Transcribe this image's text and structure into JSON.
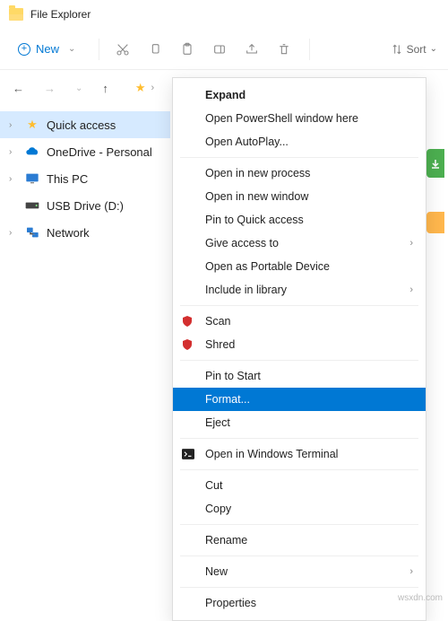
{
  "titlebar": {
    "title": "File Explorer"
  },
  "toolbar": {
    "new": "New",
    "sort": "Sort"
  },
  "sidebar": {
    "items": [
      {
        "label": "Quick access"
      },
      {
        "label": "OneDrive - Personal"
      },
      {
        "label": "This PC"
      },
      {
        "label": "USB Drive (D:)"
      },
      {
        "label": "Network"
      }
    ]
  },
  "context_menu": {
    "groups": [
      [
        {
          "label": "Expand",
          "bold": true
        },
        {
          "label": "Open PowerShell window here"
        },
        {
          "label": "Open AutoPlay..."
        }
      ],
      [
        {
          "label": "Open in new process"
        },
        {
          "label": "Open in new window"
        },
        {
          "label": "Pin to Quick access"
        },
        {
          "label": "Give access to",
          "submenu": true
        },
        {
          "label": "Open as Portable Device"
        },
        {
          "label": "Include in library",
          "submenu": true
        }
      ],
      [
        {
          "label": "Scan",
          "icon": "shield-red"
        },
        {
          "label": "Shred",
          "icon": "shield-red"
        }
      ],
      [
        {
          "label": "Pin to Start"
        },
        {
          "label": "Format...",
          "highlight": true
        },
        {
          "label": "Eject"
        }
      ],
      [
        {
          "label": "Open in Windows Terminal",
          "icon": "terminal"
        }
      ],
      [
        {
          "label": "Cut"
        },
        {
          "label": "Copy"
        }
      ],
      [
        {
          "label": "Rename"
        }
      ],
      [
        {
          "label": "New",
          "submenu": true
        }
      ],
      [
        {
          "label": "Properties"
        }
      ]
    ]
  },
  "watermark": "wsxdn.com"
}
